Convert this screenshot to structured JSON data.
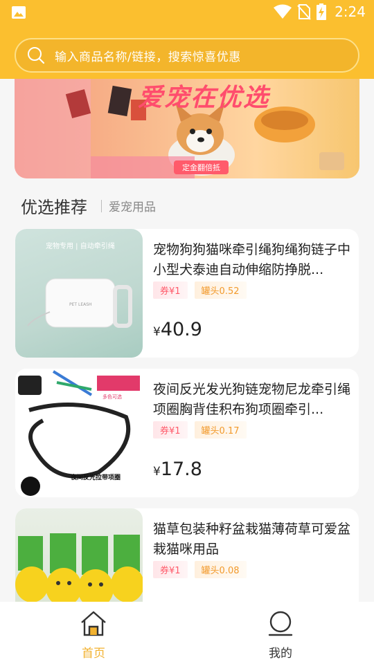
{
  "status_bar": {
    "time": "2:24",
    "icons": [
      "gallery-icon",
      "wifi-icon",
      "no-sim-icon",
      "battery-charging-icon"
    ]
  },
  "search": {
    "placeholder": "输入商品名称/链接，搜索惊喜优惠",
    "icon": "search-icon"
  },
  "banner": {
    "title": "爱宠在优选",
    "tag": "定金翻倍抵"
  },
  "section": {
    "title": "优选推荐",
    "subtitle": "爱宠用品"
  },
  "products": [
    {
      "name": "宠物狗狗猫咪牵引绳狗绳狗链子中小型犬泰迪自动伸缩防挣脱...",
      "coupon": "券¥1",
      "can": "罐头0.52",
      "currency": "¥",
      "price": "40.9",
      "thumb_text": [
        "宠物专用 | 自动牵引绳",
        "PET LEASH"
      ]
    },
    {
      "name": "夜间反光发光狗链宠物尼龙牵引绳项圈胸背佳积布狗项圈牵引...",
      "coupon": "券¥1",
      "can": "罐头0.17",
      "currency": "¥",
      "price": "17.8",
      "thumb_text": [
        "夜间反光拉带项圈",
        "多色可选"
      ]
    },
    {
      "name": "猫草包装种籽盆栽猫薄荷草可爱盆栽猫咪用品",
      "coupon": "券¥1",
      "can": "罐头0.08",
      "currency": "¥",
      "price": "",
      "thumb_text": []
    }
  ],
  "bottom_nav": [
    {
      "label": "首页",
      "icon": "home-icon",
      "active": true
    },
    {
      "label": "我的",
      "icon": "profile-icon",
      "active": false
    }
  ],
  "colors": {
    "brand": "#fbbf2f",
    "active_nav": "#f2b230",
    "coupon": "#ff5a6a",
    "can": "#f29a2c"
  }
}
